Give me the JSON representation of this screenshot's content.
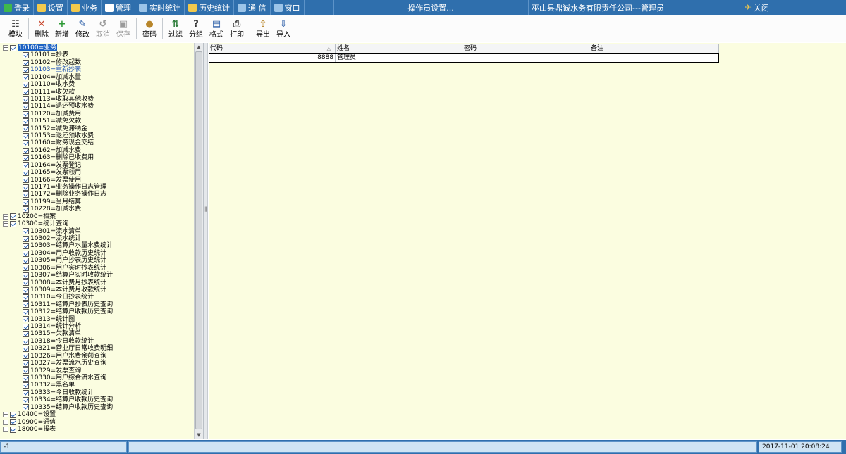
{
  "menubar": {
    "items": [
      {
        "label": "登录",
        "icon": "login-icon",
        "color": "#3fb84c"
      },
      {
        "label": "设置",
        "icon": "settings-icon",
        "color": "#f2c94c"
      },
      {
        "label": "业务",
        "icon": "business-icon",
        "color": "#f2c94c"
      },
      {
        "label": "管理",
        "icon": "manage-icon",
        "color": "#ffffff"
      },
      {
        "label": "实时统计",
        "icon": "realtime-stats-icon",
        "color": "#9cc4e8"
      },
      {
        "label": "历史统计",
        "icon": "history-stats-icon",
        "color": "#f2c94c"
      },
      {
        "label": "通 信",
        "icon": "communication-icon",
        "color": "#9cc4e8"
      },
      {
        "label": "窗口",
        "icon": "window-icon",
        "color": "#9cc4e8"
      }
    ],
    "operator_status": "操作员设置...",
    "company": "巫山县鼎诚水务有限责任公司---管理员",
    "close_label": "关闭"
  },
  "toolbar": {
    "buttons": [
      {
        "label": "模块",
        "icon": "module-icon",
        "glyph": "☷",
        "disabled": false
      },
      {
        "label": "删除",
        "icon": "delete-icon",
        "glyph": "✕",
        "disabled": false
      },
      {
        "label": "新增",
        "icon": "add-icon",
        "glyph": "+",
        "disabled": false
      },
      {
        "label": "修改",
        "icon": "edit-icon",
        "glyph": "✎",
        "disabled": false
      },
      {
        "label": "取消",
        "icon": "cancel-icon",
        "glyph": "↺",
        "disabled": true
      },
      {
        "label": "保存",
        "icon": "save-icon",
        "glyph": "▣",
        "disabled": true
      },
      {
        "label": "密码",
        "icon": "password-icon",
        "glyph": "●",
        "disabled": false
      },
      {
        "label": "过滤",
        "icon": "filter-icon",
        "glyph": "⇅",
        "disabled": false
      },
      {
        "label": "分组",
        "icon": "group-icon",
        "glyph": "?",
        "disabled": false
      },
      {
        "label": "格式",
        "icon": "format-icon",
        "glyph": "▤",
        "disabled": false
      },
      {
        "label": "打印",
        "icon": "print-icon",
        "glyph": "⎙",
        "disabled": false
      },
      {
        "label": "导出",
        "icon": "export-icon",
        "glyph": "⇧",
        "disabled": false
      },
      {
        "label": "导入",
        "icon": "import-icon",
        "glyph": "⇩",
        "disabled": false
      }
    ]
  },
  "tree": [
    {
      "label": "10100=业务",
      "level": 0,
      "expander": "−",
      "selected": true
    },
    {
      "label": "10101=抄表",
      "level": 1
    },
    {
      "label": "10102=修改起数",
      "level": 1
    },
    {
      "label": "10103=重新抄表",
      "level": 1,
      "link": true
    },
    {
      "label": "10104=加减水量",
      "level": 1
    },
    {
      "label": "10110=收水费",
      "level": 1
    },
    {
      "label": "10111=收欠款",
      "level": 1
    },
    {
      "label": "10113=收取其他收费",
      "level": 1
    },
    {
      "label": "10114=退还预收水费",
      "level": 1
    },
    {
      "label": "10120=加减费用",
      "level": 1
    },
    {
      "label": "10151=减免欠款",
      "level": 1
    },
    {
      "label": "10152=减免滞纳金",
      "level": 1
    },
    {
      "label": "10153=退还预收水费",
      "level": 1
    },
    {
      "label": "10160=财务现金交结",
      "level": 1
    },
    {
      "label": "10162=加减水费",
      "level": 1
    },
    {
      "label": "10163=删除已收费用",
      "level": 1
    },
    {
      "label": "10164=发票登记",
      "level": 1
    },
    {
      "label": "10165=发票领用",
      "level": 1
    },
    {
      "label": "10166=发票使用",
      "level": 1
    },
    {
      "label": "10171=业务操作日志管理",
      "level": 1
    },
    {
      "label": "10172=删除业务操作日志",
      "level": 1
    },
    {
      "label": "10199=当月结算",
      "level": 1
    },
    {
      "label": "10228=加减水费",
      "level": 1
    },
    {
      "label": "10200=档案",
      "level": 0,
      "expander": "+"
    },
    {
      "label": "10300=统计查询",
      "level": 0,
      "expander": "−"
    },
    {
      "label": "10301=流水清单",
      "level": 1
    },
    {
      "label": "10302=流水统计",
      "level": 1
    },
    {
      "label": "10303=结算户水量水费统计",
      "level": 1
    },
    {
      "label": "10304=用户收款历史统计",
      "level": 1
    },
    {
      "label": "10305=用户抄表历史统计",
      "level": 1
    },
    {
      "label": "10306=用户实时抄表统计",
      "level": 1
    },
    {
      "label": "10307=结算户实时收款统计",
      "level": 1
    },
    {
      "label": "10308=本计费月抄表统计",
      "level": 1
    },
    {
      "label": "10309=本计费月收款统计",
      "level": 1
    },
    {
      "label": "10310=今日抄表统计",
      "level": 1
    },
    {
      "label": "10311=结算户抄表历史查询",
      "level": 1
    },
    {
      "label": "10312=结算户收款历史查询",
      "level": 1
    },
    {
      "label": "10313=统计图",
      "level": 1
    },
    {
      "label": "10314=统计分析",
      "level": 1
    },
    {
      "label": "10315=欠款清单",
      "level": 1
    },
    {
      "label": "10318=今日收款统计",
      "level": 1
    },
    {
      "label": "10321=营业厅日常收费明细",
      "level": 1
    },
    {
      "label": "10326=用户水费余额查询",
      "level": 1
    },
    {
      "label": "10327=发票流水历史查询",
      "level": 1
    },
    {
      "label": "10329=发票查询",
      "level": 1
    },
    {
      "label": "10330=用户综合流水查询",
      "level": 1
    },
    {
      "label": "10332=黑名单",
      "level": 1
    },
    {
      "label": "10333=今日收款统计",
      "level": 1
    },
    {
      "label": "10334=结算户收款历史查询",
      "level": 1
    },
    {
      "label": "10335=结算户收款历史查询",
      "level": 1
    },
    {
      "label": "10400=设置",
      "level": 0,
      "expander": "+"
    },
    {
      "label": "10900=通信",
      "level": 0,
      "expander": "+"
    },
    {
      "label": "18000=报表",
      "level": 0,
      "expander": "+"
    }
  ],
  "grid": {
    "columns": [
      "代码",
      "姓名",
      "密码",
      "备注"
    ],
    "sort_indicator": "△",
    "rows": [
      {
        "code": "8888",
        "name": "管理员",
        "password": "",
        "note": ""
      }
    ]
  },
  "statusbar": {
    "left": "-1",
    "datetime": "2017-11-01  20:08:24"
  },
  "scrollbar": {
    "up": "▲",
    "down": "▼",
    "grip": "‖"
  }
}
